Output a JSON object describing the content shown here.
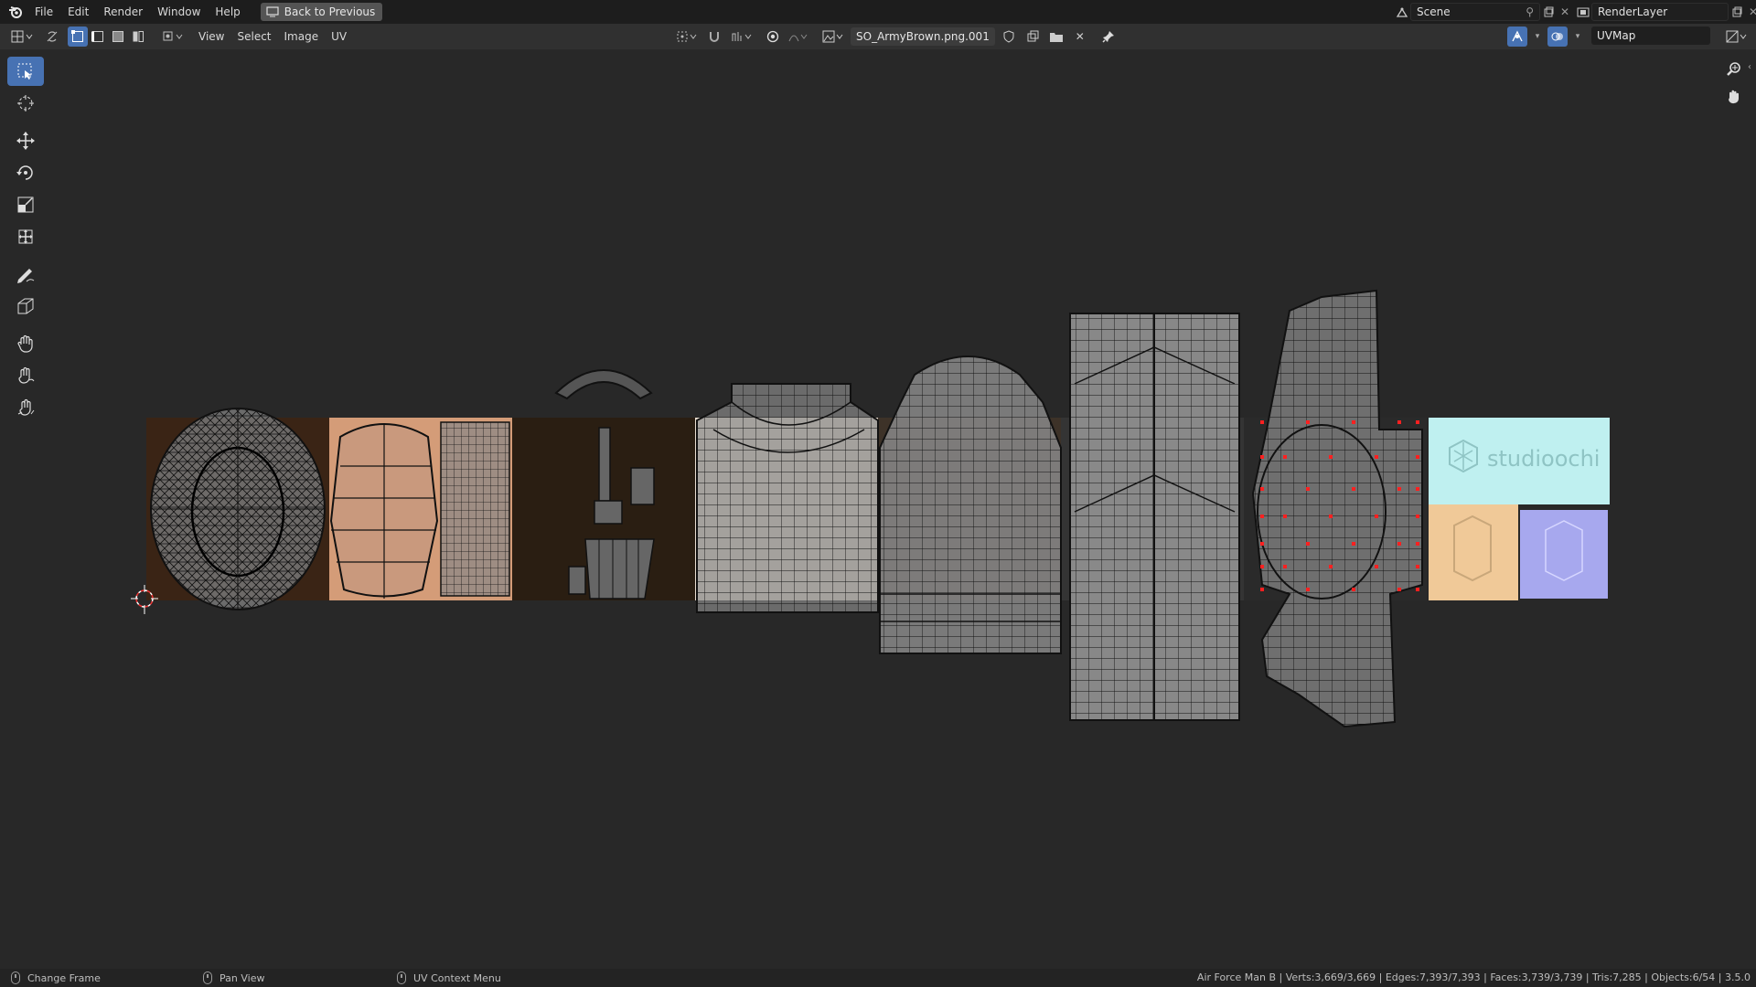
{
  "topbar": {
    "menus": [
      "File",
      "Edit",
      "Render",
      "Window",
      "Help"
    ],
    "back_button": "Back to Previous",
    "scene": "Scene",
    "render_layer": "RenderLayer"
  },
  "header": {
    "menus": [
      "View",
      "Select",
      "Image",
      "UV"
    ],
    "image_name": "SO_ArmyBrown.png.001",
    "uv_map": "UVMap"
  },
  "tools": [
    "select-box",
    "cursor",
    "move",
    "rotate",
    "scale",
    "transform",
    "annotate",
    "rip-region",
    "grab",
    "relax",
    "pinch"
  ],
  "texture": {
    "logo_text": "studioochi"
  },
  "statusbar": {
    "hints": [
      "Change Frame",
      "Pan View",
      "UV Context Menu"
    ],
    "stats": "Air Force Man B | Verts:3,669/3,669 | Edges:7,393/7,393 | Faces:3,739/3,739 | Tris:7,285 | Objects:6/54 | 3.5.0"
  },
  "colors": {
    "accent": "#4772b3",
    "panel": "#303030",
    "background": "#282828",
    "selected_vertex": "#ff2020"
  }
}
